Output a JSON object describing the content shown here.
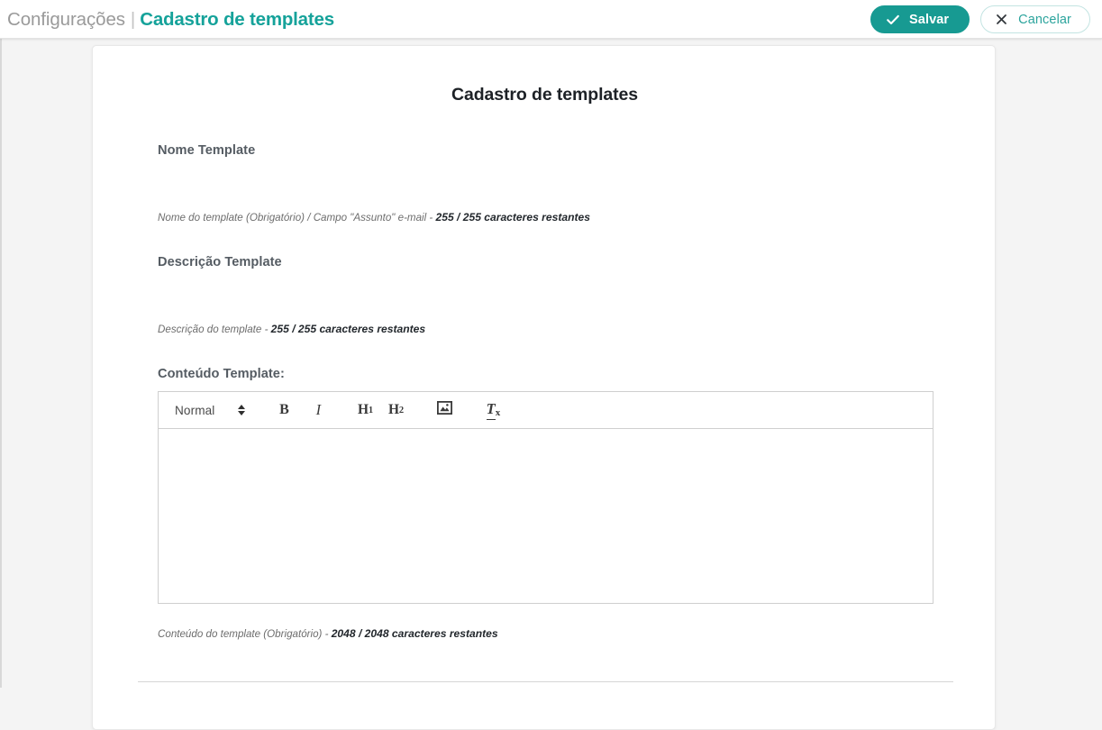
{
  "topbar": {
    "breadcrumb_parent": "Configurações",
    "breadcrumb_separator": "|",
    "breadcrumb_current": "Cadastro de templates",
    "save_label": "Salvar",
    "cancel_label": "Cancelar",
    "save_icon": "check-icon",
    "cancel_icon": "close-icon",
    "accent_color": "#179A92",
    "cancel_text_color": "#2CA49D"
  },
  "page": {
    "title": "Cadastro de templates"
  },
  "form": {
    "nome": {
      "label": "Nome Template",
      "value": "",
      "placeholder": "",
      "hint_prefix": "Nome do template (Obrigatório) / Campo \"Assunto\" e-mail - ",
      "hint_counter": "255 / 255 caracteres restantes"
    },
    "descricao": {
      "label": "Descrição Template",
      "value": "",
      "placeholder": "",
      "hint_prefix": "Descrição do template - ",
      "hint_counter": "255 / 255 caracteres restantes"
    },
    "conteudo": {
      "label": "Conteúdo Template:",
      "value": "",
      "hint_prefix": "Conteúdo do template (Obrigatório) - ",
      "hint_counter": "2048 / 2048 caracteres restantes"
    }
  },
  "editor": {
    "format_selected": "Normal",
    "format_arrows_icon": "chevron-up-down-icon",
    "buttons": [
      {
        "name": "bold",
        "label": "B",
        "icon": "bold-icon"
      },
      {
        "name": "italic",
        "label": "I",
        "icon": "italic-icon"
      },
      {
        "name": "heading-1",
        "label": "H",
        "sub": "1",
        "icon": "heading-1-icon"
      },
      {
        "name": "heading-2",
        "label": "H",
        "sub": "2",
        "icon": "heading-2-icon"
      },
      {
        "name": "insert-image",
        "label": "",
        "icon": "image-icon"
      },
      {
        "name": "clear-formatting",
        "label": "T",
        "sub": "x",
        "icon": "clear-formatting-icon"
      }
    ]
  }
}
